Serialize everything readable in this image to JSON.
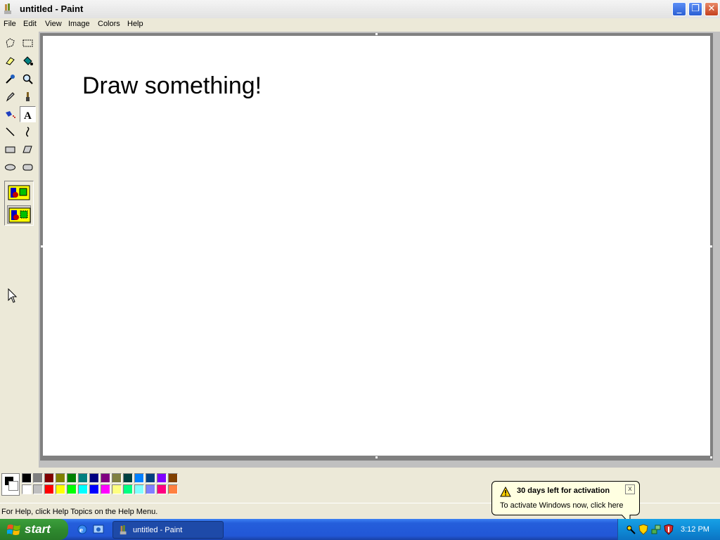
{
  "window": {
    "title": "untitled - Paint",
    "minimize_glyph": "_",
    "maximize_glyph": "❐",
    "close_glyph": "✕"
  },
  "menu": [
    "File",
    "Edit",
    "View",
    "Image",
    "Colors",
    "Help"
  ],
  "tools": [
    {
      "name": "free-form-select",
      "icon": "free-select-icon"
    },
    {
      "name": "select",
      "icon": "rect-select-icon"
    },
    {
      "name": "eraser",
      "icon": "eraser-icon"
    },
    {
      "name": "fill-with-color",
      "icon": "bucket-icon"
    },
    {
      "name": "pick-color",
      "icon": "eyedropper-icon"
    },
    {
      "name": "magnifier",
      "icon": "magnifier-icon"
    },
    {
      "name": "pencil",
      "icon": "pencil-icon"
    },
    {
      "name": "brush",
      "icon": "brush-icon"
    },
    {
      "name": "airbrush",
      "icon": "airbrush-icon"
    },
    {
      "name": "text",
      "icon": "text-icon",
      "active": true
    },
    {
      "name": "line",
      "icon": "line-icon"
    },
    {
      "name": "curve",
      "icon": "curve-icon"
    },
    {
      "name": "rectangle",
      "icon": "rectangle-icon"
    },
    {
      "name": "polygon",
      "icon": "polygon-icon"
    },
    {
      "name": "ellipse",
      "icon": "ellipse-icon"
    },
    {
      "name": "rounded-rectangle",
      "icon": "rounded-rect-icon"
    }
  ],
  "text_tool_options": [
    "opaque-background-icon",
    "transparent-background-icon"
  ],
  "canvas": {
    "text": "Draw something!"
  },
  "palette": {
    "foreground": "#000000",
    "background": "#ffffff",
    "top_row": [
      "#000000",
      "#808080",
      "#800000",
      "#808000",
      "#008000",
      "#008080",
      "#000080",
      "#800080",
      "#808040",
      "#004040",
      "#0080ff",
      "#004080",
      "#8000ff",
      "#804000"
    ],
    "bottom_row": [
      "#ffffff",
      "#c0c0c0",
      "#ff0000",
      "#ffff00",
      "#00ff00",
      "#00ffff",
      "#0000ff",
      "#ff00ff",
      "#ffff80",
      "#00ff80",
      "#80ffff",
      "#8080ff",
      "#ff0080",
      "#ff8040"
    ]
  },
  "status": {
    "text": "For Help, click Help Topics on the Help Menu."
  },
  "balloon": {
    "title": "30 days left for activation",
    "body": "To activate Windows now, click here",
    "icon": "warning-icon",
    "close_glyph": "x"
  },
  "taskbar": {
    "start_label": "start",
    "quick_launch": [
      "internet-explorer-icon",
      "show-desktop-icon"
    ],
    "task_label": "untitled - Paint",
    "tray_icons": [
      "activation-key-icon",
      "security-shield-icon",
      "network-icon",
      "antivirus-shield-icon"
    ],
    "clock": "3:12 PM"
  }
}
